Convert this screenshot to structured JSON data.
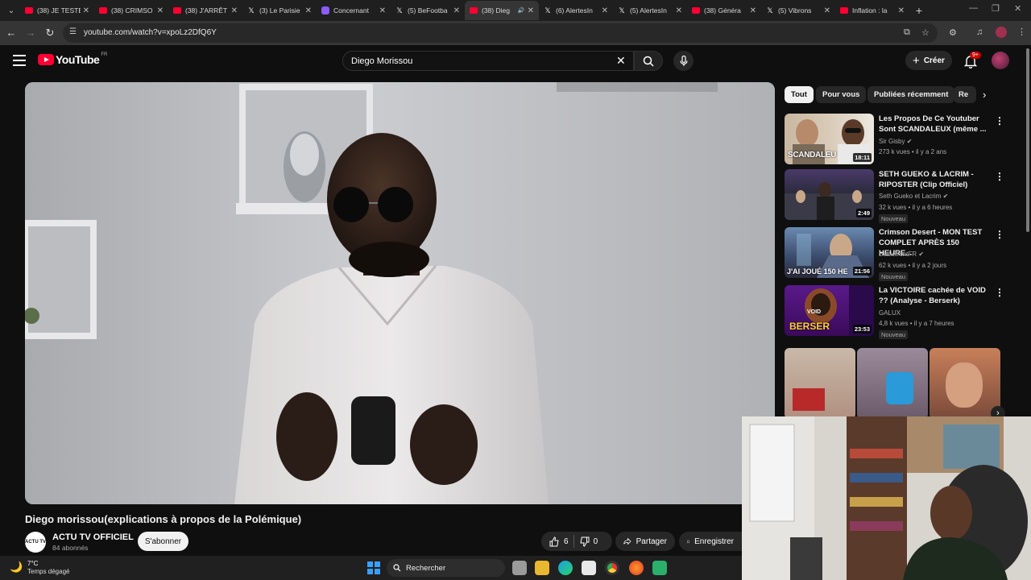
{
  "browser": {
    "tabs": [
      {
        "label": "(38) JE TESTE",
        "icon": "youtube",
        "active": false
      },
      {
        "label": "(38) CRIMSO",
        "icon": "youtube",
        "active": false
      },
      {
        "label": "(38) J'ARRÊT",
        "icon": "youtube",
        "active": false
      },
      {
        "label": "(3) Le Parisie",
        "icon": "x",
        "active": false
      },
      {
        "label": "Concernant",
        "icon": "purple",
        "active": false
      },
      {
        "label": "(5) BeFootba",
        "icon": "x",
        "active": false
      },
      {
        "label": "(38) Dieg",
        "icon": "youtube",
        "active": true
      },
      {
        "label": "(6) AlertesIn",
        "icon": "x",
        "active": false
      },
      {
        "label": "(5) AlertesIn",
        "icon": "x",
        "active": false
      },
      {
        "label": "(38) Généra",
        "icon": "youtube",
        "active": false
      },
      {
        "label": "(5) Vibrons",
        "icon": "x",
        "active": false
      },
      {
        "label": "Inflation : la",
        "icon": "youtube",
        "active": false
      }
    ],
    "url": "youtube.com/watch?v=xpoLz2DfQ6Y"
  },
  "youtube": {
    "logo_text": "YouTube",
    "region": "FR",
    "search_query": "Diego Morissou",
    "create_label": "Créer",
    "notif_badge": "9+"
  },
  "video": {
    "title": "Diego morissou(explications à propos de la Polémique)",
    "channel_name": "ACTU TV OFFICIEL",
    "channel_avatar_text": "ACTU TV",
    "subscribers": "84 abonnés",
    "subscribe_label": "S'abonner",
    "likes": "6",
    "dislikes": "0",
    "share_label": "Partager",
    "save_label": "Enregistrer"
  },
  "filters": [
    "Tout",
    "Pour vous",
    "Publiées récemment",
    "Re"
  ],
  "recommendations": [
    {
      "title": "Les Propos De Ce Youtuber Sont SCANDALEUX (même ...",
      "channel": "Sir Gisby",
      "meta": "273 k vues • il y a 2 ans",
      "duration": "18:11",
      "thumb_text": "SCANDALEU",
      "badge": ""
    },
    {
      "title": "SETH GUEKO & LACRIM - RIPOSTER (Clip Officiel)",
      "channel": "Seth Gueko et Lacrim",
      "meta": "32 k vues • il y a 6 heures",
      "duration": "2:49",
      "thumb_text": "",
      "badge": "Nouveau"
    },
    {
      "title": "Crimson Desert - MON TEST COMPLET APRÈS 150 HEURE...",
      "channel": "BattlefrontFR",
      "meta": "62 k vues • il y a 2 jours",
      "duration": "21:56",
      "thumb_text": "J'AI JOUÉ 150 HE",
      "badge": "Nouveau"
    },
    {
      "title": "La VICTOIRE cachée de VOID ?? (Analyse - Berserk)",
      "channel": "GALUX",
      "meta": "4,8 k vues • il y a 7 heures",
      "duration": "23:53",
      "thumb_text": "BERSER",
      "thumb_text2": "VOID",
      "badge": "Nouveau"
    }
  ],
  "taskbar": {
    "temperature": "7°C",
    "weather": "Temps dégagé",
    "search_label": "Rechercher"
  }
}
